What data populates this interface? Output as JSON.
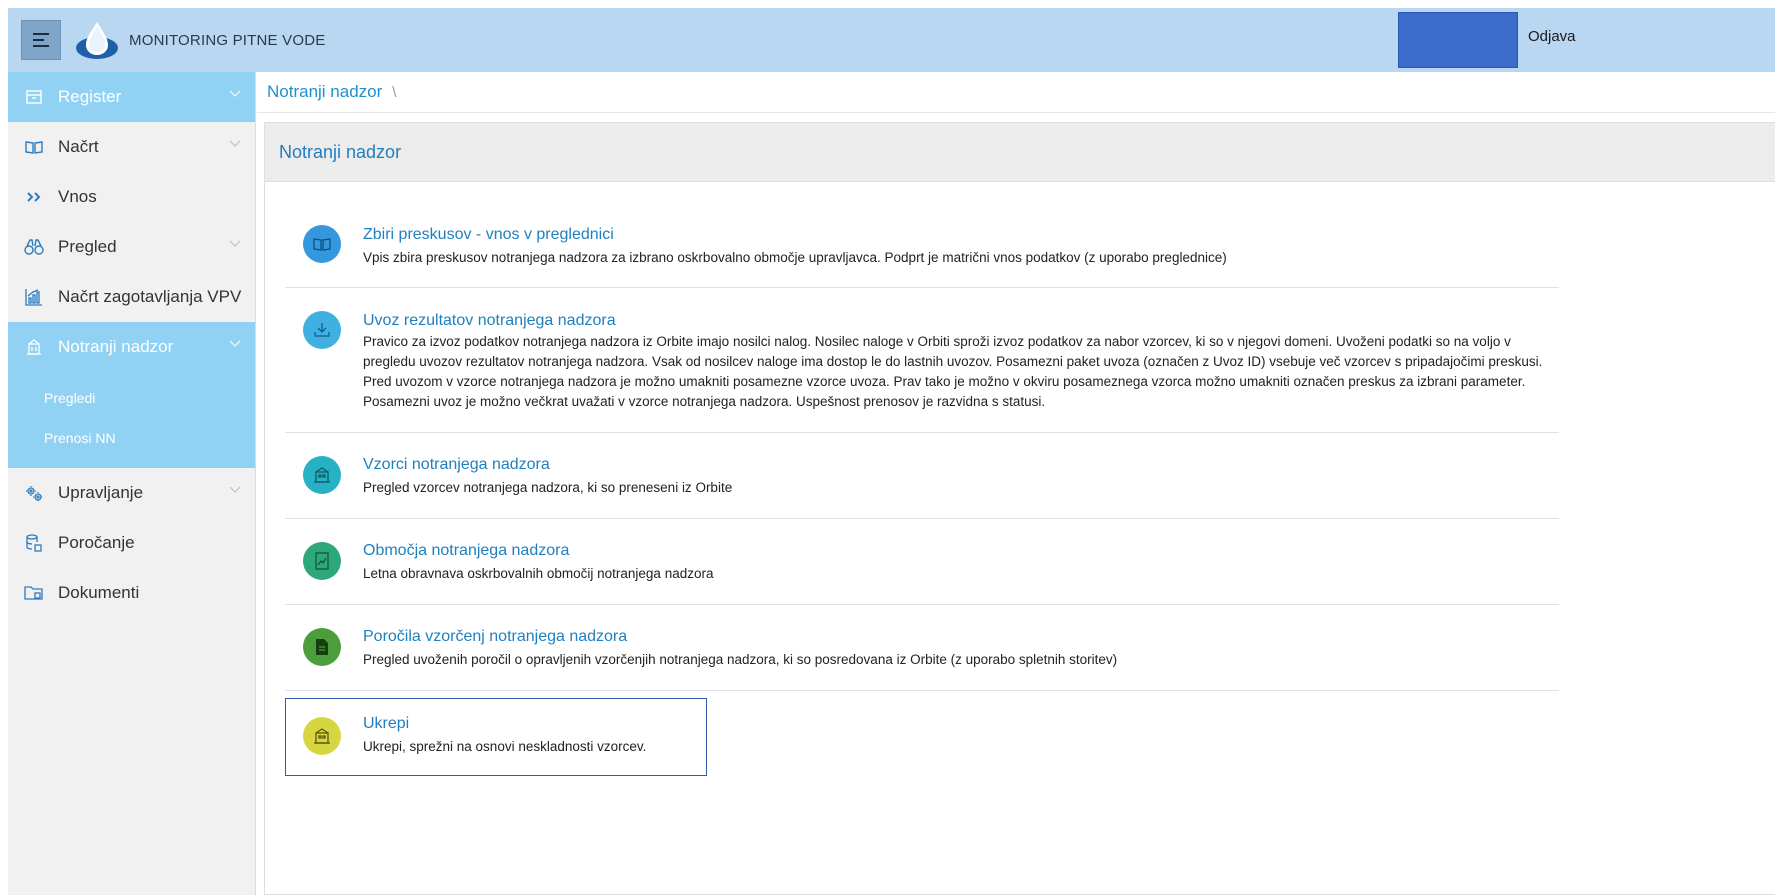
{
  "header": {
    "app_title": "MONITORING PITNE VODE",
    "logout_label": "Odjava",
    "user_box_color": "#3d6ccc"
  },
  "sidebar": {
    "items": [
      {
        "label": "Register",
        "icon": "archive-box-icon",
        "expandable": true,
        "active": true
      },
      {
        "label": "Načrt",
        "icon": "open-book-icon",
        "expandable": true
      },
      {
        "label": "Vnos",
        "icon": "double-chevron-right-icon",
        "expandable": false
      },
      {
        "label": "Pregled",
        "icon": "binoculars-icon",
        "expandable": true
      },
      {
        "label": "Načrt zagotavljanja VPV",
        "icon": "bar-chart-icon",
        "expandable": false
      },
      {
        "label": "Notranji nadzor",
        "icon": "building-icon",
        "expandable": true,
        "active": true
      },
      {
        "label": "Upravljanje",
        "icon": "gears-icon",
        "expandable": true
      },
      {
        "label": "Poročanje",
        "icon": "database-report-icon",
        "expandable": false
      },
      {
        "label": "Dokumenti",
        "icon": "folder-icon",
        "expandable": false
      }
    ],
    "sub_items": [
      "Pregledi",
      "Prenosi NN"
    ]
  },
  "breadcrumb": {
    "crumb": "Notranji nadzor",
    "separator": "\\"
  },
  "panel": {
    "title": "Notranji nadzor",
    "cards": [
      {
        "title": "Zbiri preskusov - vnos v preglednici",
        "desc": "Vpis zbira preskusov notranjega nadzora za izbrano oskrbovalno območje upravljavca. Podprt je matrični vnos podatkov (z uporabo preglednice)",
        "icon": "book-icon",
        "color": "#3598dc"
      },
      {
        "title": "Uvoz rezultatov notranjega nadzora",
        "desc": "Pravico za izvoz podatkov notranjega nadzora iz Orbite imajo nosilci nalog. Nosilec naloge v Orbiti sproži izvoz podatkov za nabor vzorcev, ki so v njegovi domeni. Uvoženi podatki so na voljo v pregledu uvozov rezultatov notranjega nadzora. Vsak od nosilcev naloge ima dostop le do lastnih uvozov. Posamezni paket uvoza (označen z Uvoz ID) vsebuje več vzorcev s pripadajočimi preskusi. Pred uvozom v vzorce notranjega nadzora je možno umakniti posamezne vzorce uvoza. Prav tako je možno v okviru posameznega vzorca možno umakniti označen preskus za izbrani parameter. Posamezni uvoz je možno večkrat uvažati v vzorce notranjega nadzora. Uspešnost prenosov je razvidna s statusi.",
        "icon": "download-icon",
        "color": "#40b0e3"
      },
      {
        "title": "Vzorci notranjega nadzora",
        "desc": "Pregled vzorcev notranjega nadzora, ki so preneseni iz Orbite",
        "icon": "building-icon",
        "color": "#26b1c4"
      },
      {
        "title": "Območja notranjega nadzora",
        "desc": "Letna obravnava oskrbovalnih območij notranjega nadzora",
        "icon": "document-chart-icon",
        "color": "#2ea77a"
      },
      {
        "title": "Poročila vzorčenj notranjega nadzora",
        "desc": "Pregled uvoženih poročil o opravljenih vzorčenjih notranjega nadzora, ki so posredovana iz Orbite (z uporabo spletnih storitev)",
        "icon": "file-icon",
        "color": "#4c9e3d"
      },
      {
        "title": "Ukrepi",
        "desc": "Ukrepi, sprežni na osnovi neskladnosti vzorcev.",
        "icon": "building-icon",
        "color": "#d8d640"
      }
    ]
  }
}
